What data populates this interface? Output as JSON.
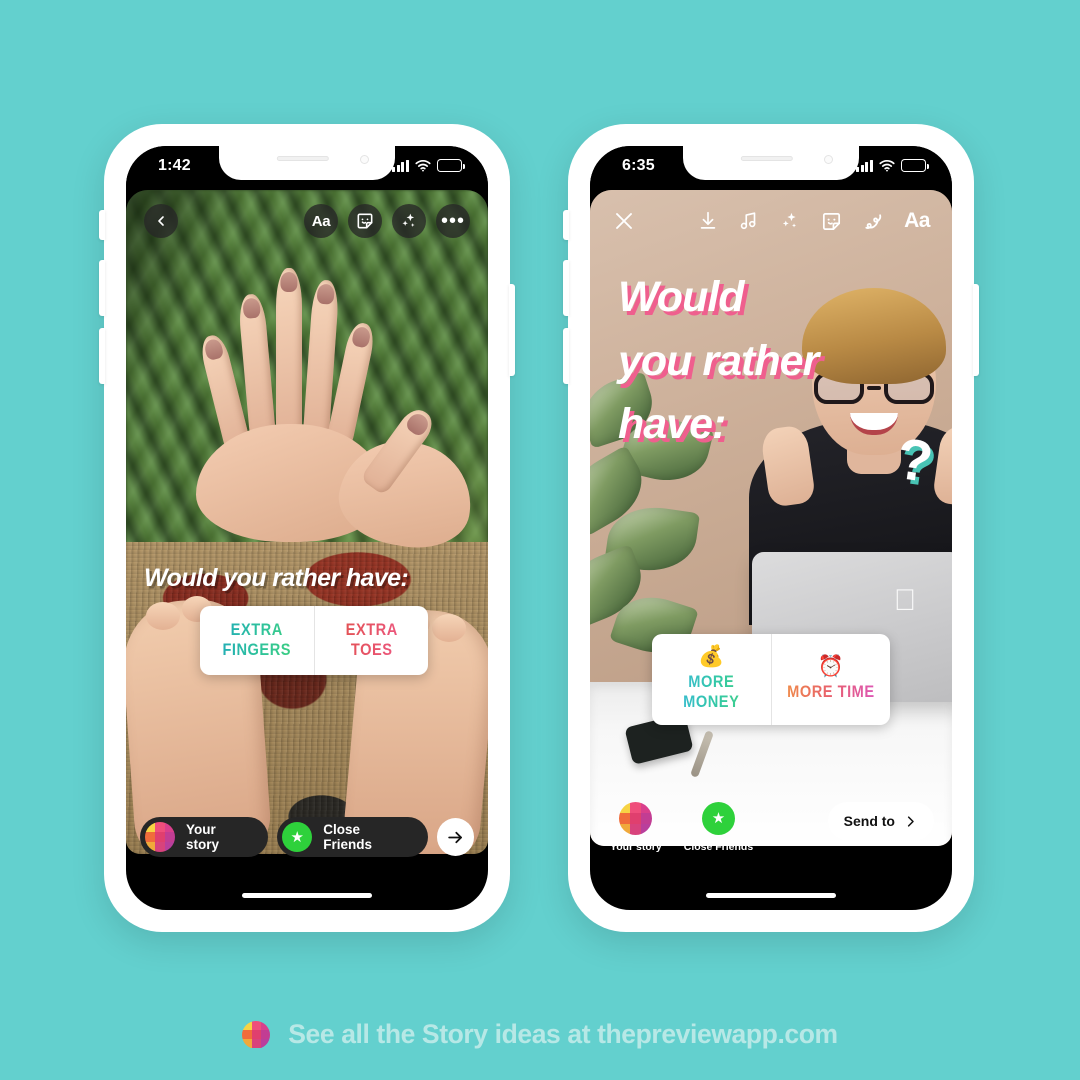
{
  "theme": {
    "background": "#63d0ce",
    "footer_text_color": "#b7e8e6",
    "accent_pink": "#ef5f8e",
    "accent_teal": "#48c3b4",
    "close_friends_green": "#2ed13b"
  },
  "phone_left": {
    "status": {
      "time": "1:42",
      "signal_icon": "signal-bars-icon",
      "wifi_icon": "wifi-icon",
      "battery_icon": "battery-icon",
      "battery_level": 100
    },
    "toolbar": {
      "back_icon": "chevron-left-icon",
      "items": [
        {
          "icon": "text-aa-icon",
          "label": "Aa"
        },
        {
          "icon": "sticker-icon",
          "label": ""
        },
        {
          "icon": "sparkles-icon",
          "label": ""
        },
        {
          "icon": "more-options-icon",
          "label": ""
        }
      ]
    },
    "headline": "Would you rather have:",
    "poll": {
      "options": [
        {
          "label": "EXTRA FINGERS",
          "emoji": "",
          "gradient": "teal-green"
        },
        {
          "label": "EXTRA TOES",
          "emoji": "",
          "gradient": "red-pink"
        }
      ]
    },
    "share": {
      "your_story_label": "Your story",
      "close_friends_label": "Close Friends",
      "next_icon": "arrow-right-icon"
    }
  },
  "phone_right": {
    "status": {
      "time": "6:35",
      "signal_icon": "signal-bars-icon",
      "wifi_icon": "wifi-icon",
      "battery_icon": "battery-icon",
      "battery_level": 55
    },
    "toolbar": {
      "close_icon": "close-x-icon",
      "items": [
        {
          "icon": "download-icon",
          "label": ""
        },
        {
          "icon": "music-note-icon",
          "label": ""
        },
        {
          "icon": "sparkles-icon",
          "label": ""
        },
        {
          "icon": "sticker-icon",
          "label": ""
        },
        {
          "icon": "draw-squiggle-icon",
          "label": ""
        },
        {
          "icon": "text-aa-icon",
          "label": "Aa"
        }
      ]
    },
    "headline_lines": [
      "Would",
      "you rather",
      "have:"
    ],
    "question_mark": "?",
    "poll": {
      "options": [
        {
          "label": "MORE MONEY",
          "emoji": "💰",
          "gradient": "blue-green"
        },
        {
          "label": "MORE TIME",
          "emoji": "⏰",
          "gradient": "orange-pink"
        }
      ]
    },
    "share": {
      "your_story_label": "Your story",
      "close_friends_label": "Close Friends",
      "send_to_label": "Send to",
      "send_to_icon": "chevron-right-icon"
    }
  },
  "footer": {
    "logo_icon": "instagram-grid-icon",
    "text": "See all the Story ideas at thepreviewapp.com"
  }
}
